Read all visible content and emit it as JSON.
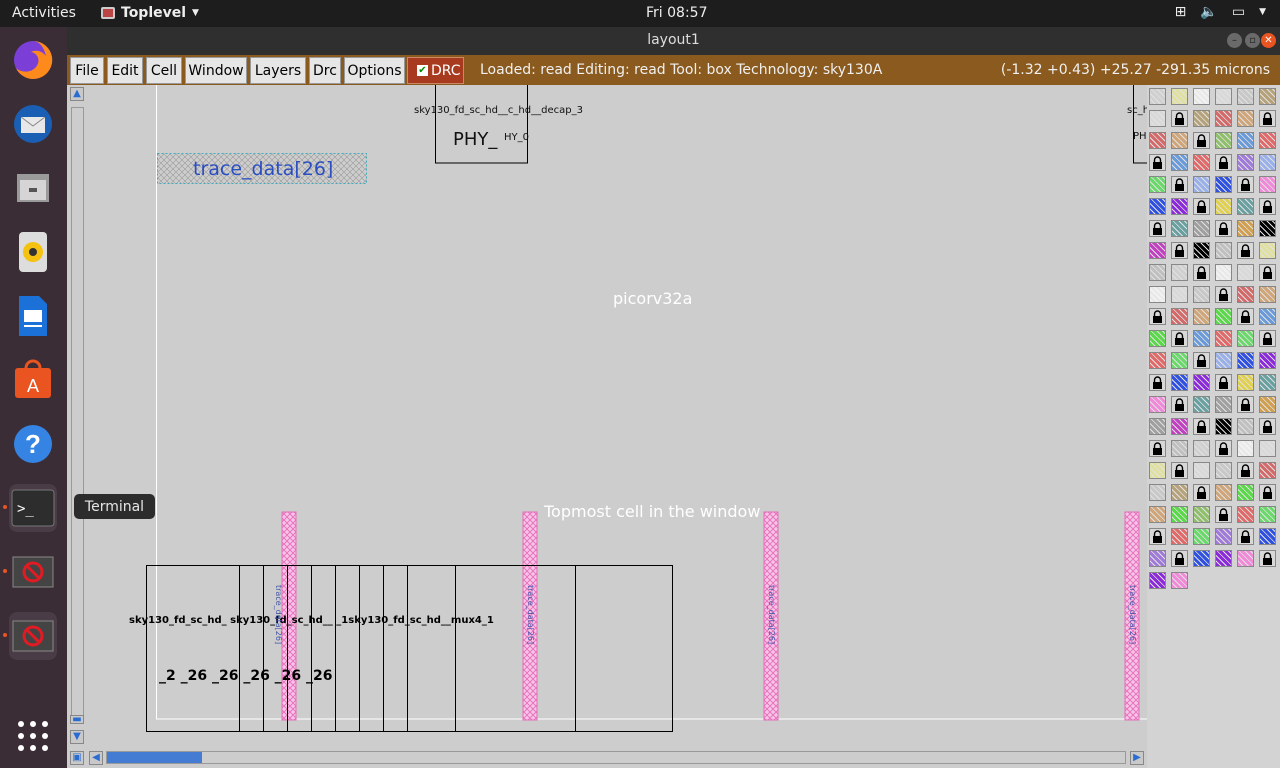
{
  "topbar": {
    "activities": "Activities",
    "app_name": "Toplevel",
    "clock": "Fri 08:57"
  },
  "dock": {
    "items": [
      {
        "name": "firefox-icon"
      },
      {
        "name": "thunderbird-icon"
      },
      {
        "name": "files-icon"
      },
      {
        "name": "rhythmbox-icon"
      },
      {
        "name": "writer-icon"
      },
      {
        "name": "software-icon"
      },
      {
        "name": "help-icon"
      },
      {
        "name": "terminal-icon"
      },
      {
        "name": "app-window-icon"
      },
      {
        "name": "app-window-icon"
      },
      {
        "name": "show-apps-icon"
      }
    ],
    "tooltip": "Terminal"
  },
  "window": {
    "title": "layout1"
  },
  "menu": {
    "items": [
      "File",
      "Edit",
      "Cell",
      "Window",
      "Layers",
      "Drc",
      "Options"
    ],
    "drc_toggle": "DRC",
    "status": "Loaded: read Editing: read Tool: box  Technology: sky130A",
    "coords": "(-1.32 +0.43) +25.27 -291.35 microns"
  },
  "canvas": {
    "cell_decap": "sky130_fd_sc_hd__c_hd__decap_3",
    "phy_label": "PHY_",
    "phy_small": "HY_0",
    "right_cell_a": "sc_h",
    "right_cell_b": "PH",
    "trace_label": "trace_data[26]",
    "top_cell": "picorv32a",
    "topmost_msg": "Topmost cell in the window",
    "mux_label": "sky130_fd_sc_hd__mux4_1",
    "row1_text": "sky130_fd_sc_hd_ sky130_fd_sc_hd__   _1sky130_fd_sc_hd__mux4_1",
    "row2_text": "_2   _26   _26   _26   _26   _26",
    "vlabel_1": "trace_data[26]",
    "vlabel_2": "trace_data[26]",
    "vlabel_3": "trace_data[26]",
    "vlabel_4": "trace_data[26]"
  },
  "colors": {
    "menubar": "#8a5a1e",
    "drc": "#a73a1f",
    "scroll_thumb": "#2a6dd2",
    "pink_wire": "#f4a3d9"
  }
}
